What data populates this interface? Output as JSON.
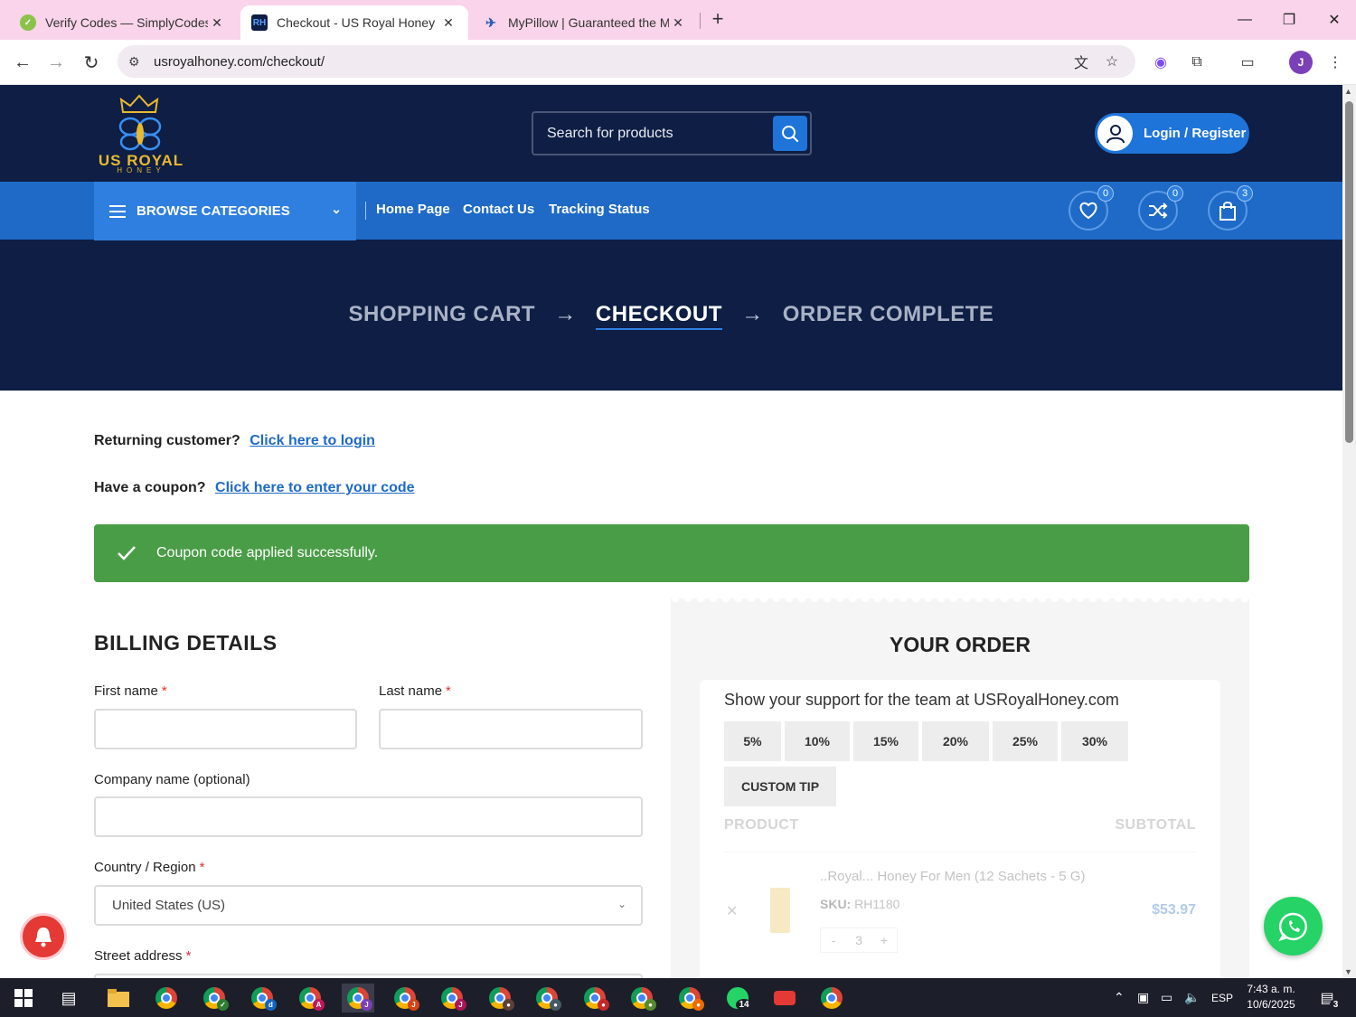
{
  "browser": {
    "tabs": [
      {
        "title": "Verify Codes — SimplyCodes",
        "active": false
      },
      {
        "title": "Checkout - US Royal Honey",
        "active": true
      },
      {
        "title": "MyPillow | Guaranteed the Most",
        "active": false
      }
    ],
    "tab_close": "✕",
    "url": "usroyalhoney.com/checkout/"
  },
  "header": {
    "logo_name": "US ROYAL",
    "logo_sub": "HONEY",
    "search_placeholder": "Search for products",
    "login_label": "Login / Register"
  },
  "nav": {
    "browse_label": "BROWSE CATEGORIES",
    "links": [
      "Home Page",
      "Contact Us",
      "Tracking Status"
    ],
    "wishlist_count": "0",
    "compare_count": "0",
    "cart_count": "3"
  },
  "steps": {
    "step1": "SHOPPING CART",
    "step2": "CHECKOUT",
    "step3": "ORDER COMPLETE",
    "arrow": "→"
  },
  "checkout": {
    "returning_text": "Returning customer?",
    "returning_link": "Click here to login",
    "coupon_text": "Have a coupon?",
    "coupon_link": "Click here to enter your code",
    "notice": "Coupon code applied successfully."
  },
  "billing": {
    "title": "BILLING DETAILS",
    "first_name": "First name",
    "last_name": "Last name",
    "company": "Company name (optional)",
    "country_label": "Country / Region",
    "country_value": "United States (US)",
    "street_label": "Street address",
    "required_mark": "*"
  },
  "order": {
    "title": "YOUR ORDER",
    "tip_text": "Show your support for the team at USRoyalHoney.com",
    "tips": [
      "5%",
      "10%",
      "15%",
      "20%",
      "25%",
      "30%"
    ],
    "custom_tip": "CUSTOM TIP",
    "col_product": "PRODUCT",
    "col_subtotal": "SUBTOTAL",
    "item_name": "..Royal... Honey For Men (12 Sachets - 5 G)",
    "sku_label": "SKU:",
    "sku_value": "RH1180",
    "price": "$53.97",
    "qty": "3",
    "qty_minus": "-",
    "qty_plus": "+",
    "remove": "✕"
  },
  "taskbar": {
    "time": "7:43 a. m.",
    "date": "10/6/2025",
    "lang": "ESP",
    "whatsapp_badge": "14",
    "notif_count": "3"
  }
}
